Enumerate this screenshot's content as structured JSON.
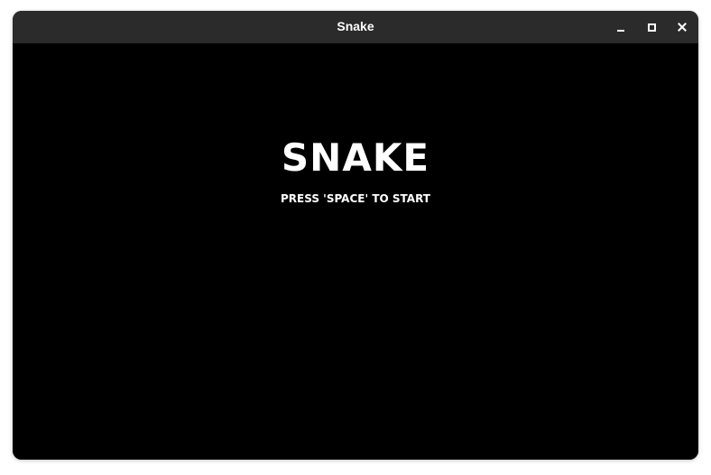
{
  "window": {
    "title": "Snake",
    "controls": {
      "minimize_icon": "minimize-icon",
      "maximize_icon": "maximize-icon",
      "close_icon": "close-icon"
    }
  },
  "game": {
    "title": "SNAKE",
    "prompt": "PRESS 'SPACE' TO START",
    "background_color": "#000000",
    "text_color": "#ffffff"
  },
  "colors": {
    "titlebar": "#2b2b2b",
    "titlebar_text": "#ffffff"
  }
}
